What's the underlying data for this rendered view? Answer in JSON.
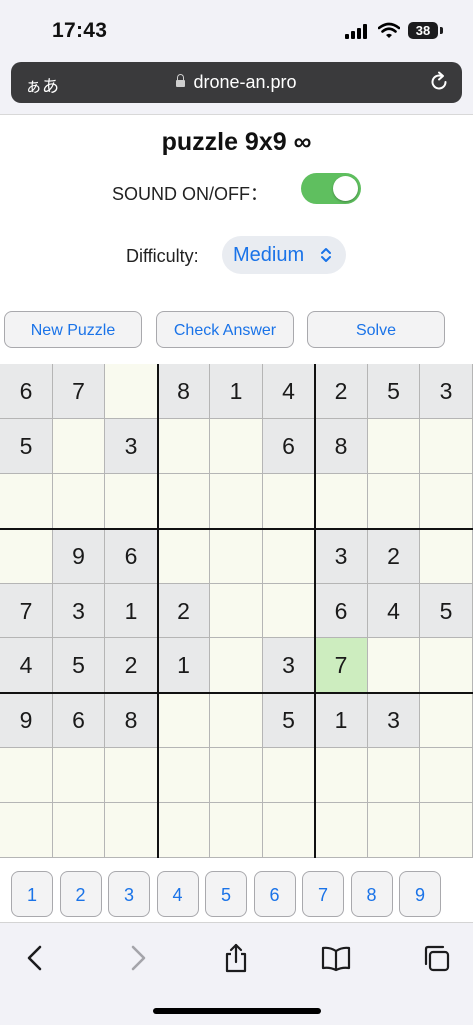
{
  "status_bar": {
    "time": "17:43",
    "battery": "38"
  },
  "browser": {
    "aa_label": "ぁあ",
    "url": "drone-an.pro"
  },
  "page": {
    "title": "puzzle 9x9 ∞",
    "sound_label": "SOUND ON/OFF：",
    "sound_on": true,
    "difficulty_label": "Difficulty:",
    "difficulty_value": "Medium",
    "buttons": {
      "new_puzzle": "New Puzzle",
      "check_answer": "Check Answer",
      "solve": "Solve"
    }
  },
  "grid": {
    "rows": [
      [
        "6",
        "7",
        "",
        "8",
        "1",
        "4",
        "2",
        "5",
        "3"
      ],
      [
        "5",
        "",
        "3",
        "",
        "",
        "6",
        "8",
        "",
        ""
      ],
      [
        "",
        "",
        "",
        "",
        "",
        "",
        "",
        "",
        ""
      ],
      [
        "",
        "9",
        "6",
        "",
        "",
        "",
        "3",
        "2",
        ""
      ],
      [
        "7",
        "3",
        "1",
        "2",
        "",
        "",
        "6",
        "4",
        "5"
      ],
      [
        "4",
        "5",
        "2",
        "1",
        "",
        "3",
        "7",
        "",
        ""
      ],
      [
        "9",
        "6",
        "8",
        "",
        "",
        "5",
        "1",
        "3",
        ""
      ],
      [
        "",
        "",
        "",
        "",
        "",
        "",
        "",
        "",
        ""
      ],
      [
        "",
        "",
        "",
        "",
        "",
        "",
        "",
        "",
        ""
      ]
    ],
    "selected_cell": {
      "row": 5,
      "col": 6
    }
  },
  "number_pad": [
    "1",
    "2",
    "3",
    "4",
    "5",
    "6",
    "7",
    "8",
    "9"
  ],
  "toolbar": {
    "back": "back-icon",
    "forward": "forward-icon",
    "share": "share-icon",
    "bookmarks": "bookmarks-icon",
    "tabs": "tabs-icon"
  },
  "colors": {
    "accent": "#1a73e8",
    "toggle_on": "#5fbf5f",
    "given_cell": "#e8e9ea",
    "empty_cell": "#f9faef",
    "selected_cell": "#cdedbf"
  }
}
